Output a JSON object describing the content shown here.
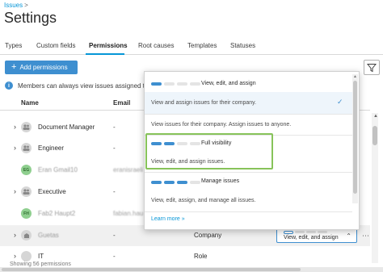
{
  "breadcrumb": {
    "parent": "Issues",
    "separator": ">"
  },
  "page": {
    "title": "Settings"
  },
  "tabs": [
    {
      "label": "Types"
    },
    {
      "label": "Custom fields"
    },
    {
      "label": "Permissions"
    },
    {
      "label": "Root causes"
    },
    {
      "label": "Templates"
    },
    {
      "label": "Statuses"
    }
  ],
  "active_tab": "Permissions",
  "toolbar": {
    "add_label": "Add permissions",
    "add_icon": "plus-icon",
    "filter_icon": "filter-icon"
  },
  "info": {
    "icon": "info-icon",
    "text": "Members can always view issues assigned to th"
  },
  "table": {
    "headers": {
      "name": "Name",
      "email": "Email"
    },
    "rows": [
      {
        "name": "Document Manager",
        "email": "-",
        "role": "",
        "type": "group"
      },
      {
        "name": "Engineer",
        "email": "-",
        "role": "",
        "type": "group"
      },
      {
        "name": "Eran Gmail10",
        "initials": "EG",
        "email": "eranisraeli",
        "role": "",
        "type": "user"
      },
      {
        "name": "Executive",
        "email": "-",
        "role": "",
        "type": "group"
      },
      {
        "name": "Fab2 Haupt2",
        "initials": "FH",
        "email": "fabian.hau",
        "role": "",
        "type": "user"
      },
      {
        "name": "Guetas",
        "email": "-",
        "role": "Company",
        "type": "company",
        "permission": "View, edit, and assign"
      },
      {
        "name": "IT",
        "email": "-",
        "role": "Role",
        "type": "group"
      }
    ]
  },
  "footer": {
    "count_text": "Showing 56 permissions"
  },
  "dropdown": {
    "options": [
      {
        "title": "View, edit, and assign",
        "description": "View and assign issues for their company.",
        "level": 1,
        "selected": true
      },
      {
        "title": "",
        "description": "View issues for their company. Assign issues to anyone.",
        "level": 1,
        "selected": false
      },
      {
        "title": "Full visibility",
        "description": "View, edit, and assign issues.",
        "level": 2,
        "selected": false
      },
      {
        "title": "Manage issues",
        "description": "View, edit, assign, and manage all issues.",
        "level": 3,
        "selected": false
      }
    ],
    "learn_more": "Learn more »"
  },
  "colors": {
    "accent": "#3e8fd0",
    "focus": "#87c35a",
    "link": "#0696d7"
  }
}
